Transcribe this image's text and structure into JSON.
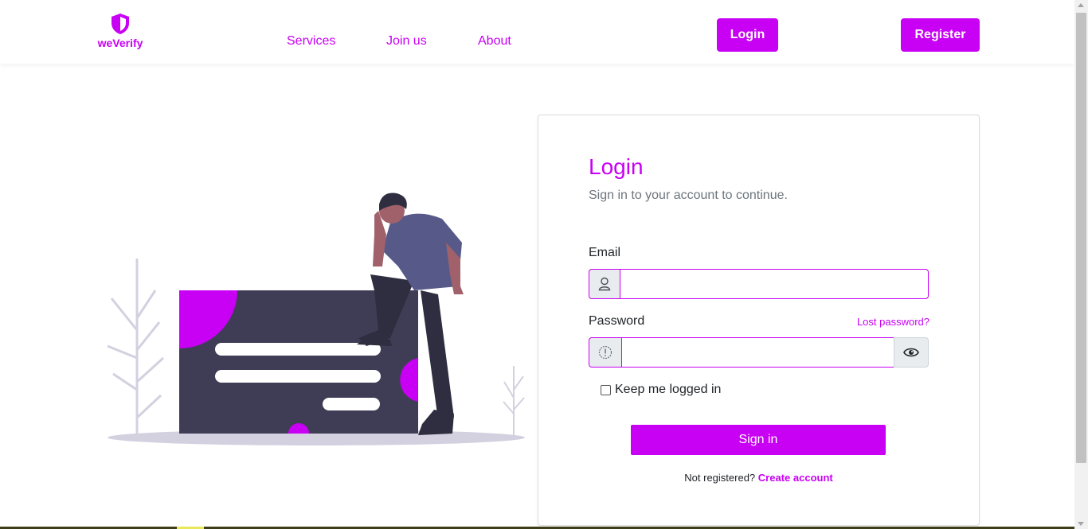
{
  "brand": {
    "name": "weVerify",
    "color": "#c800f4",
    "icon": "shield-icon"
  },
  "nav": {
    "links": [
      "Services",
      "Join us",
      "About"
    ],
    "login_label": "Login",
    "register_label": "Register"
  },
  "form": {
    "title": "Login",
    "subtitle": "Sign in to your account to continue.",
    "email_label": "Email",
    "email_value": "",
    "email_icon": "user-icon",
    "password_label": "Password",
    "password_value": "",
    "password_icon": "exclamation-icon",
    "show_password_icon": "eye-icon",
    "lost_password": "Lost password?",
    "remember_label": "Keep me logged in",
    "remember_checked": false,
    "submit_label": "Sign in",
    "not_registered": "Not registered?",
    "create_account": "Create account"
  }
}
